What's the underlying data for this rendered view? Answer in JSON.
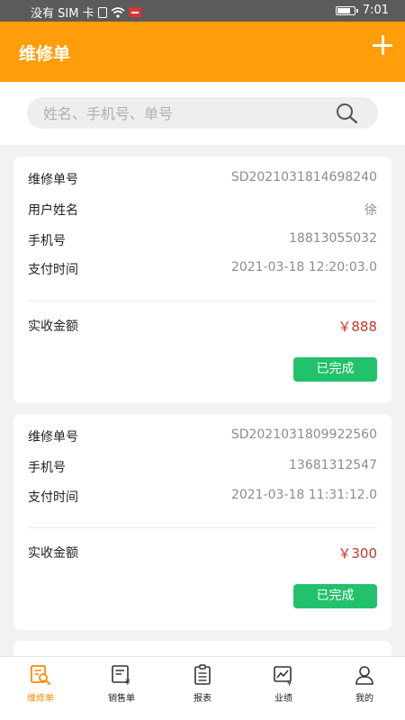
{
  "status_bar": {
    "carrier": "没有 SIM 卡",
    "time": "7:01"
  },
  "header": {
    "title": "维修单"
  },
  "search": {
    "placeholder": "姓名、手机号、单号"
  },
  "orders": [
    {
      "rows": [
        {
          "label": "维修单号",
          "value": "SD2021031814698240"
        },
        {
          "label": "用户姓名",
          "value": "徐"
        },
        {
          "label": "手机号",
          "value": "18813055032"
        },
        {
          "label": "支付时间",
          "value": "2021-03-18 12:20:03.0"
        }
      ],
      "amount_label": "实收金额",
      "amount": "￥888",
      "status": "已完成"
    },
    {
      "rows": [
        {
          "label": "维修单号",
          "value": "SD2021031809922560"
        },
        {
          "label": "手机号",
          "value": "13681312547"
        },
        {
          "label": "支付时间",
          "value": "2021-03-18 11:31:12.0"
        }
      ],
      "amount_label": "实收金额",
      "amount": "￥300",
      "status": "已完成"
    }
  ],
  "nav": [
    {
      "label": "维修单",
      "icon": "repair-order-icon",
      "active": true
    },
    {
      "label": "销售单",
      "icon": "sales-order-icon",
      "active": false
    },
    {
      "label": "报表",
      "icon": "report-icon",
      "active": false
    },
    {
      "label": "业绩",
      "icon": "performance-icon",
      "active": false
    },
    {
      "label": "我的",
      "icon": "profile-icon",
      "active": false
    }
  ],
  "colors": {
    "accent": "#ff9d0a",
    "status_green": "#22c16b",
    "amount_red": "#c8352b",
    "nav_active": "#ff8a00"
  }
}
